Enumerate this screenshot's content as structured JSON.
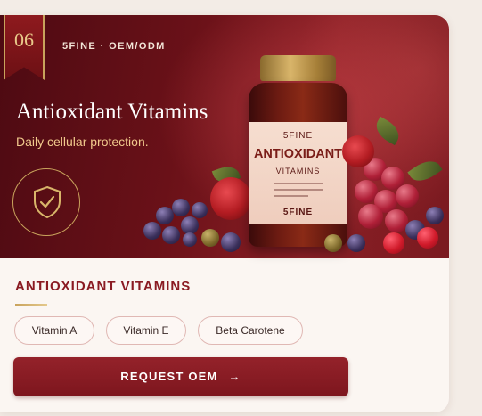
{
  "card": {
    "badge_number": "06",
    "brand_line": "5FINE · OEM/ODM",
    "hero_title": "Antioxidant Vitamins",
    "hero_subtitle": "Daily cellular protection.",
    "shield_icon": "shield-check-icon",
    "product": {
      "label_brand": "5FINE",
      "label_name": "ANTIOXIDANT",
      "label_sub": "VITAMINS",
      "label_brand_bottom": "5FINE"
    },
    "section_title": "ANTIOXIDANT VITAMINS",
    "tags": [
      "Vitamin A",
      "Vitamin E",
      "Beta Carotene"
    ],
    "cta_label": "REQUEST OEM",
    "cta_arrow": "→",
    "colors": {
      "accent": "#8a1a22",
      "gold": "#c9a35c",
      "background": "#fbf6f2"
    }
  }
}
